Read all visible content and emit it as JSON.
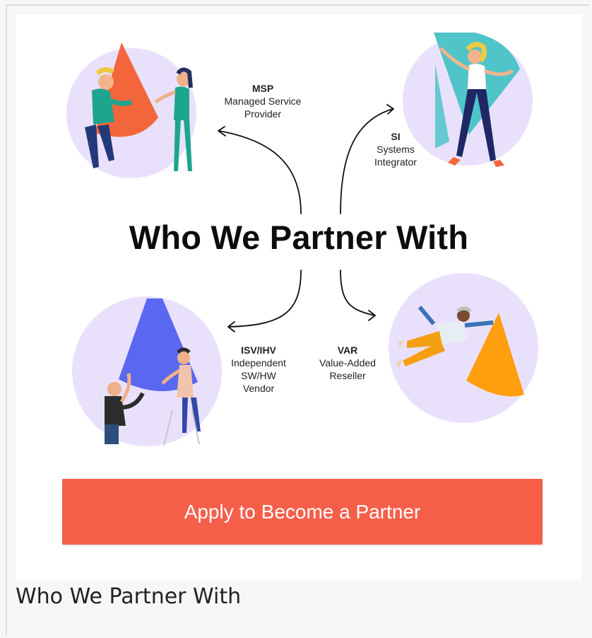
{
  "headline": "Who We Partner With",
  "caption": "Who We Partner With",
  "cta": {
    "label": "Apply to Become a Partner",
    "color": "#f55f4a"
  },
  "partners": [
    {
      "id": "msp",
      "abbr": "MSP",
      "full": "Managed Service Provider"
    },
    {
      "id": "si",
      "abbr": "SI",
      "full": "Systems Integrator"
    },
    {
      "id": "isv",
      "abbr": "ISV/IHV",
      "full": "Independent SW/HW Vendor"
    },
    {
      "id": "var",
      "abbr": "VAR",
      "full": "Value-Added Reseller"
    }
  ],
  "colors": {
    "circle": "#e9e1fb",
    "msp_cone": "#f3663c",
    "si_shape": "#4fc4c9",
    "isv_cone": "#5a67f0",
    "var_cone": "#ff9e0f"
  }
}
